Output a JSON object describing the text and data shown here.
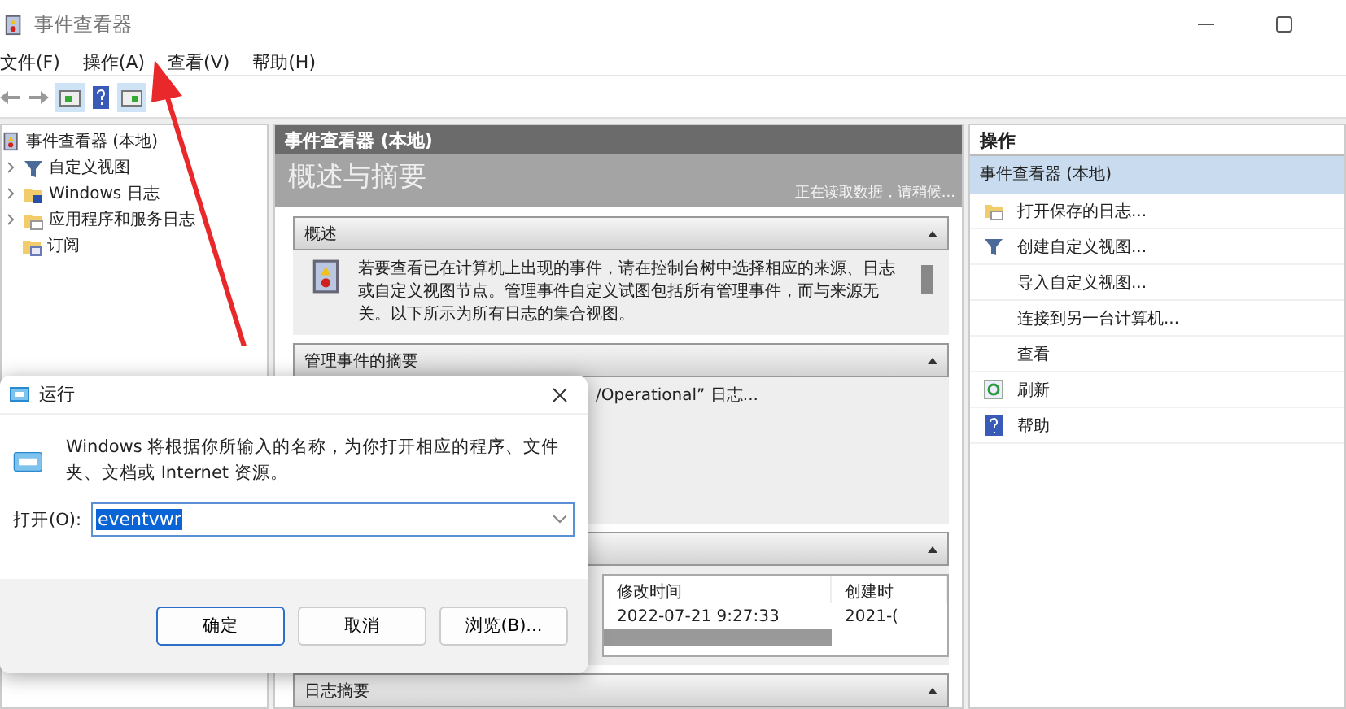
{
  "window": {
    "title": "事件查看器"
  },
  "menu": [
    {
      "label": "文件(F)"
    },
    {
      "label": "操作(A)"
    },
    {
      "label": "查看(V)"
    },
    {
      "label": "帮助(H)"
    }
  ],
  "tree": {
    "root": "事件查看器 (本地)",
    "items": [
      {
        "label": "自定义视图",
        "expandable": true,
        "kind": "filter"
      },
      {
        "label": "Windows 日志",
        "expandable": true,
        "kind": "windows"
      },
      {
        "label": "应用程序和服务日志",
        "expandable": true,
        "kind": "folder"
      },
      {
        "label": "订阅",
        "expandable": false,
        "kind": "subscribe"
      }
    ]
  },
  "center": {
    "header": "事件查看器 (本地)",
    "title": "概述与摘要",
    "status": "正在读取数据，请稍候...",
    "sections": [
      {
        "kind": "text",
        "title": "概述",
        "text": "若要查看已在计算机上出现的事件，请在控制台树中选择相应的来源、日志或自定义视图节点。管理事件自定义试图包括所有管理事件，而与来源无关。以下所示为所有日志的集合视图。"
      },
      {
        "kind": "text",
        "title": "管理事件的摘要",
        "text": "/Operational” 日志..."
      },
      {
        "kind": "table",
        "columns": [
          "修改时间",
          "创建时"
        ],
        "rows": [
          [
            "2022-07-21 9:27:33",
            "2021-("
          ]
        ]
      },
      {
        "kind": "empty",
        "title": "日志摘要"
      }
    ]
  },
  "actions": {
    "title": "操作",
    "items": [
      {
        "label": "事件查看器 (本地)",
        "kind": "group",
        "selected": true
      },
      {
        "label": "打开保存的日志...",
        "kind": "open",
        "selected": false
      },
      {
        "label": "创建自定义视图...",
        "kind": "filter",
        "selected": false
      },
      {
        "label": "导入自定义视图...",
        "kind": "plain",
        "selected": false
      },
      {
        "label": "连接到另一台计算机...",
        "kind": "plain",
        "selected": false
      },
      {
        "label": "查看",
        "kind": "plain",
        "selected": false
      },
      {
        "label": "刷新",
        "kind": "refresh",
        "selected": false
      },
      {
        "label": "帮助",
        "kind": "help",
        "selected": false
      }
    ]
  },
  "run_dialog": {
    "title": "运行",
    "message": "Windows 将根据你所输入的名称，为你打开相应的程序、文件夹、文档或 Internet 资源。",
    "field_label": "打开(O):",
    "value": "eventvwr",
    "buttons": [
      {
        "label": "确定",
        "default": true
      },
      {
        "label": "取消",
        "default": false
      },
      {
        "label": "浏览(B)...",
        "default": false
      }
    ]
  }
}
